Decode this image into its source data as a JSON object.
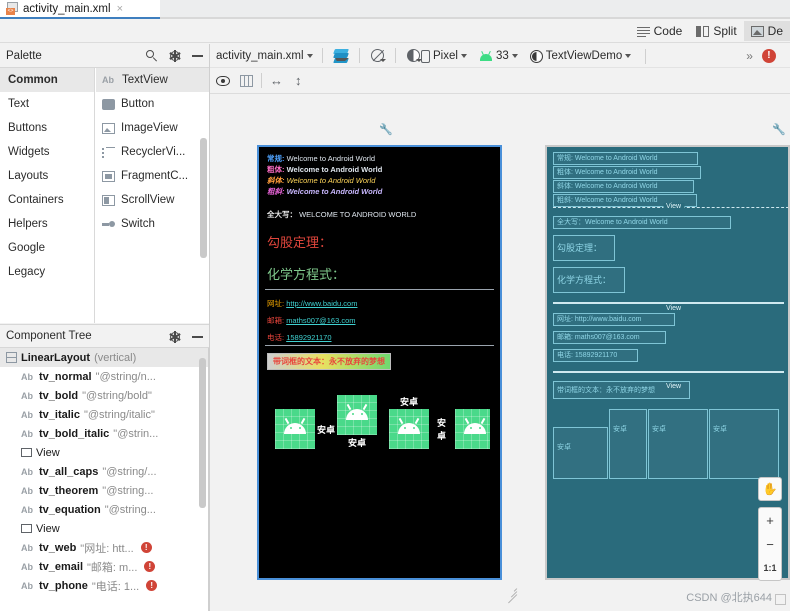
{
  "tab": {
    "label": "activity_main.xml",
    "close": "×",
    "icon": "xml-file-icon"
  },
  "editor_modes": [
    {
      "label": "Code",
      "icon": "code-icon",
      "selected": false
    },
    {
      "label": "Split",
      "icon": "split-icon",
      "selected": false
    },
    {
      "label": "De",
      "icon": "design-icon",
      "selected": true
    }
  ],
  "palette": {
    "title": "Palette",
    "icons": [
      "search-icon",
      "gear-icon",
      "minimize-icon"
    ],
    "categories": [
      {
        "label": "Common",
        "selected": true
      },
      {
        "label": "Text",
        "selected": false
      },
      {
        "label": "Buttons",
        "selected": false
      },
      {
        "label": "Widgets",
        "selected": false
      },
      {
        "label": "Layouts",
        "selected": false
      },
      {
        "label": "Containers",
        "selected": false
      },
      {
        "label": "Helpers",
        "selected": false
      },
      {
        "label": "Google",
        "selected": false
      },
      {
        "label": "Legacy",
        "selected": false
      }
    ],
    "items": [
      {
        "label": "TextView",
        "icon": "ab-icon",
        "selected": true
      },
      {
        "label": "Button",
        "icon": "button-icon",
        "selected": false
      },
      {
        "label": "ImageView",
        "icon": "image-icon",
        "selected": false
      },
      {
        "label": "RecyclerVi...",
        "icon": "recycler-icon",
        "selected": false
      },
      {
        "label": "FragmentC...",
        "icon": "fragment-icon",
        "selected": false
      },
      {
        "label": "ScrollView",
        "icon": "scroll-icon",
        "selected": false
      },
      {
        "label": "Switch",
        "icon": "switch-icon",
        "selected": false
      }
    ]
  },
  "component_tree": {
    "title": "Component Tree",
    "icons": [
      "gear-icon",
      "minimize-icon"
    ],
    "rows": [
      {
        "icon": "linearlayout-icon",
        "id": "LinearLayout",
        "value": "(vertical)",
        "error": false,
        "root": true,
        "selected": true
      },
      {
        "icon": "ab-icon",
        "id": "tv_normal",
        "value": "\"@string/n...",
        "error": false
      },
      {
        "icon": "ab-icon",
        "id": "tv_bold",
        "value": "\"@string/bold\"",
        "error": false
      },
      {
        "icon": "ab-icon",
        "id": "tv_italic",
        "value": "\"@string/italic\"",
        "error": false
      },
      {
        "icon": "ab-icon",
        "id": "tv_bold_italic",
        "value": "\"@strin...",
        "error": false
      },
      {
        "icon": "view-icon",
        "id": "View",
        "value": "",
        "error": false
      },
      {
        "icon": "ab-icon",
        "id": "tv_all_caps",
        "value": "\"@string/...",
        "error": false
      },
      {
        "icon": "ab-icon",
        "id": "tv_theorem",
        "value": "\"@string...",
        "error": false
      },
      {
        "icon": "ab-icon",
        "id": "tv_equation",
        "value": "\"@string...",
        "error": false
      },
      {
        "icon": "view-icon",
        "id": "View",
        "value": "",
        "error": false
      },
      {
        "icon": "ab-icon",
        "id": "tv_web",
        "value": "\"网址: htt...",
        "error": true
      },
      {
        "icon": "ab-icon",
        "id": "tv_email",
        "value": "\"邮箱: m...",
        "error": true
      },
      {
        "icon": "ab-icon",
        "id": "tv_phone",
        "value": "\"电话: 1...",
        "error": true
      }
    ],
    "error_glyph": "!"
  },
  "design_toolbar": {
    "file": "activity_main.xml",
    "icons": [
      "layers-icon",
      "no-theme-icon",
      "day-night-icon"
    ],
    "device": "Pixel",
    "api": "33",
    "theme": "TextViewDemo",
    "more": "»",
    "error_count_glyph": "!",
    "row2_icons": [
      "eye-icon",
      "columns-icon",
      "horizontal-resize-icon",
      "vertical-resize-icon"
    ]
  },
  "preview": {
    "wrench_icon": "wrench-icon",
    "design_lines": [
      {
        "label": "常规:",
        "label_color": "lbl-blue",
        "value": "Welcome to Android World",
        "value_class": "v-white",
        "style": ""
      },
      {
        "label": "粗体:",
        "label_color": "lbl-pink",
        "value": "Welcome to Android World",
        "value_class": "v-white",
        "style": "bold"
      },
      {
        "label": "斜体:",
        "label_color": "lbl-org",
        "value": "Welcome to Android World",
        "value_class": "v-yellow",
        "style": "ital"
      },
      {
        "label": "粗斜:",
        "label_color": "lbl-magenta",
        "value": "Welcome to Android World",
        "value_class": "v-lav",
        "style": "bold ital"
      }
    ],
    "all_caps": {
      "label": "全大写：",
      "value": "WELCOME TO ANDROID WORLD"
    },
    "theorem": "勾股定理：",
    "equation": "化学方程式：",
    "links": [
      {
        "label": "网址:",
        "value": "http://www.baidu.com",
        "label_class": "lbl-amber"
      },
      {
        "label": "邮箱:",
        "value": "maths007@163.com",
        "label_class": "lbl-red"
      },
      {
        "label": "电话:",
        "value": "15892921170",
        "label_class": "lbl-red"
      }
    ],
    "boxed_text": "带词框的文本：永不放弃的梦想",
    "droid_label": "安卓",
    "droid_icon": "android-robot-icon",
    "blueprint_divider_label": "View"
  },
  "zoom_controls": {
    "pan": "✋",
    "zoom_in": "+",
    "zoom_out": "−",
    "reset": "1:1"
  },
  "watermark": "CSDN @北执644"
}
